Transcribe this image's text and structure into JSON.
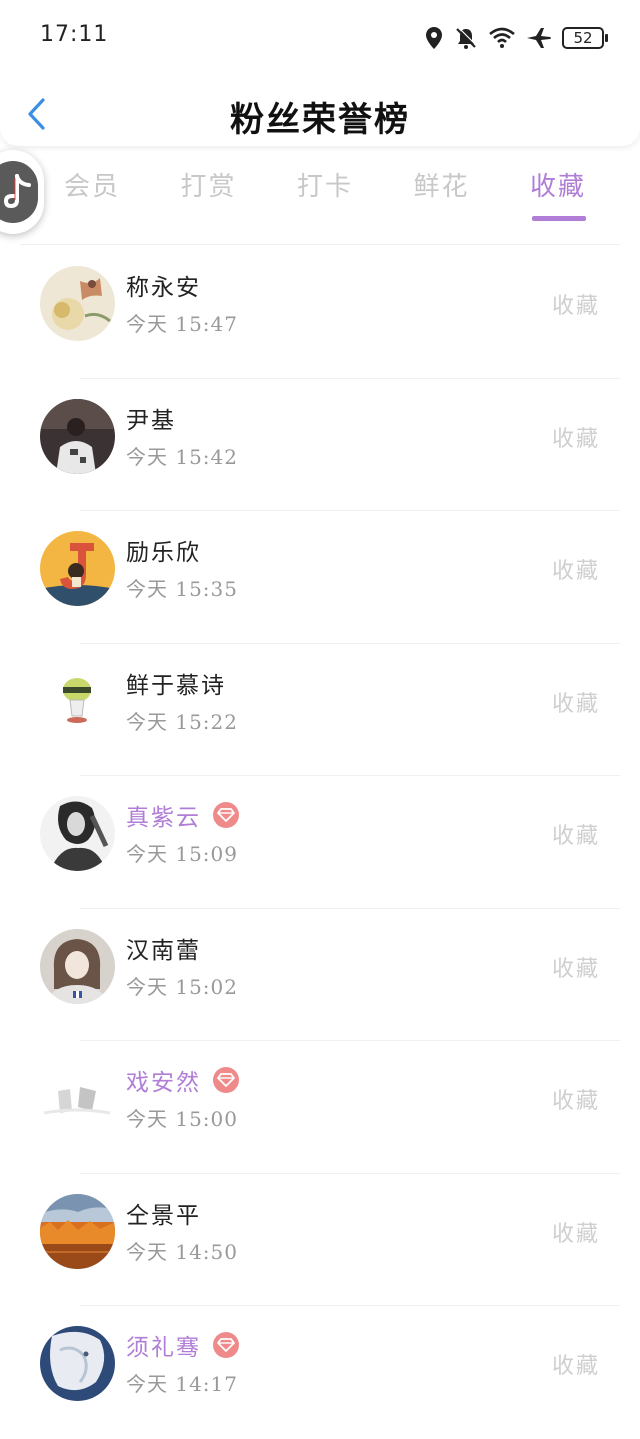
{
  "status_bar": {
    "time": "17:11",
    "battery": "52",
    "icons": [
      "location-icon",
      "bell-muted-icon",
      "wifi-icon",
      "airplane-icon"
    ]
  },
  "header": {
    "title": "粉丝荣誉榜",
    "back_icon": "chevron-left-icon"
  },
  "tabs": [
    {
      "label": "会员",
      "active": false
    },
    {
      "label": "打赏",
      "active": false
    },
    {
      "label": "打卡",
      "active": false
    },
    {
      "label": "鲜花",
      "active": false
    },
    {
      "label": "收藏",
      "active": true
    }
  ],
  "colors": {
    "accent": "#b07ed6",
    "vip_badge": "#ef8a8a",
    "inactive_text": "#c8c8c8"
  },
  "fans": [
    {
      "name": "称永安",
      "time": "今天 15:47",
      "action": "收藏",
      "vip": false
    },
    {
      "name": "尹基",
      "time": "今天 15:42",
      "action": "收藏",
      "vip": false
    },
    {
      "name": "励乐欣",
      "time": "今天 15:35",
      "action": "收藏",
      "vip": false
    },
    {
      "name": "鲜于慕诗",
      "time": "今天 15:22",
      "action": "收藏",
      "vip": false
    },
    {
      "name": "真紫云",
      "time": "今天 15:09",
      "action": "收藏",
      "vip": true
    },
    {
      "name": "汉南蕾",
      "time": "今天 15:02",
      "action": "收藏",
      "vip": false
    },
    {
      "name": "戏安然",
      "time": "今天 15:00",
      "action": "收藏",
      "vip": true
    },
    {
      "name": "仝景平",
      "time": "今天 14:50",
      "action": "收藏",
      "vip": false
    },
    {
      "name": "须礼骞",
      "time": "今天 14:17",
      "action": "收藏",
      "vip": true
    }
  ]
}
